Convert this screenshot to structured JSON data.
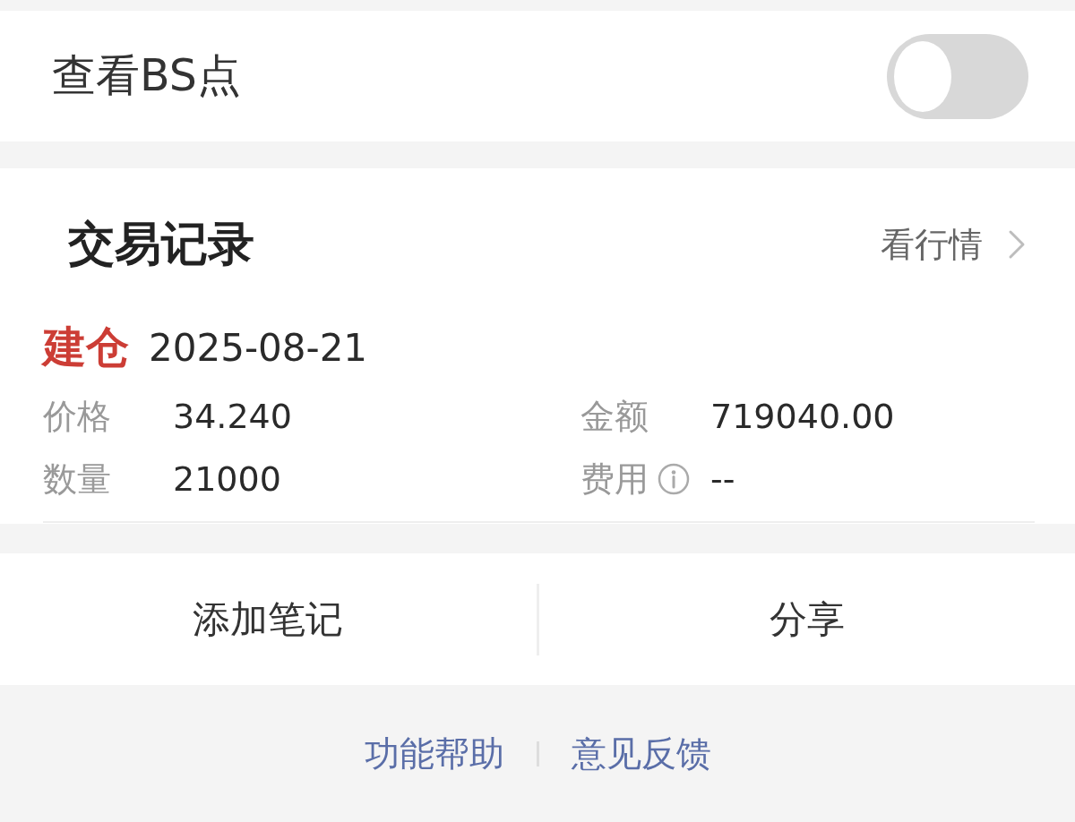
{
  "settings": {
    "label": "查看BS点",
    "on": false
  },
  "trade_records": {
    "title": "交易记录",
    "link": "看行情",
    "records": [
      {
        "action": "建仓",
        "date": "2025-08-21",
        "fields": [
          {
            "label": "价格",
            "value": "34.240",
            "info": false
          },
          {
            "label": "金额",
            "value": "719040.00",
            "info": false
          },
          {
            "label": "数量",
            "value": "21000",
            "info": false
          },
          {
            "label": "费用",
            "value": "--",
            "info": true
          }
        ]
      }
    ]
  },
  "actions": [
    "添加笔记",
    "分享"
  ],
  "footer_links": [
    "功能帮助",
    "意见反馈"
  ]
}
